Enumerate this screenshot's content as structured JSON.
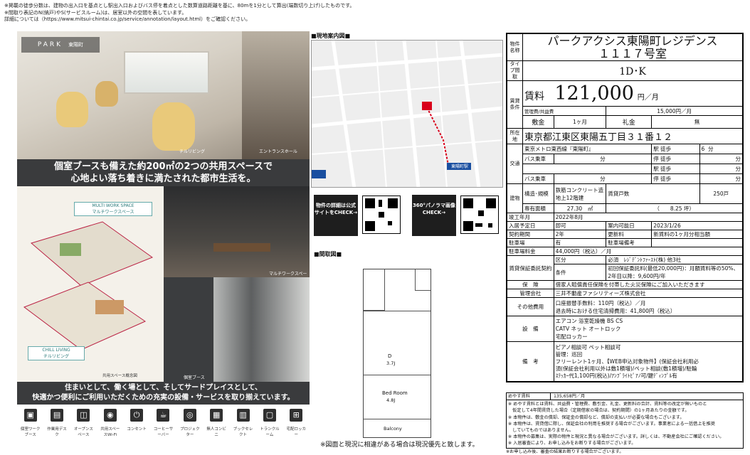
{
  "notes": [
    "※掲載の徒歩分数は、建物の出入口を基点とし駅出入口およびバス停を着点とした数算道路距離を基に、80mを1分として算出(端数切り上げ)したものです。",
    "※間取り表記のN(納戸)やS(サービスルーム)は、居室以外の空間を表しています。",
    "詳細については（https://www.mitsui-chintai.co.jp/service/annotation/layout.html）をご確認ください。"
  ],
  "photos": {
    "logo_text": "PARK",
    "logo_sub": "東陽町",
    "caption1_line1": "個室ブースも備えた約200㎡の2つの共用スペースで",
    "caption1_line2": "心地よい落ち着きに満たされた都市生活を。",
    "caption2_line1": "住まいとして、働く場として、そしてサードプレイスとして、",
    "caption2_line2": "快適かつ便利にご利用いただくための充実の設備・サービスを取り揃えています。",
    "plan_label_top": "MULTI WORK SPACE",
    "plan_label_top_jp": "マルチワークスペース",
    "plan_label_bottom": "CHILL LIVING",
    "plan_label_bottom_jp": "チルリビング",
    "plan_caption": "共用スペース概念図",
    "sub1": "チルリビング",
    "sub2": "エントランスホール",
    "sub3": "マルチワークスペース",
    "sub4": "個室ブース",
    "icons": [
      "個室ワークブース",
      "作業用デスク",
      "オープンスペース",
      "共用スペースWi-Fi",
      "コンセント",
      "コーヒーサーバー",
      "プロジェクター",
      "無人コンビニ",
      "ブックセレクト",
      "トランクルーム",
      "宅配ロッカー"
    ]
  },
  "map": {
    "title": "■現地案内図■",
    "station": "東陽町駅"
  },
  "qr": {
    "badge1": "物件の詳細は公式サイトをCHECK→",
    "badge2": "360°パノラマ画像CHECK→"
  },
  "floorplan": {
    "title": "■間取図■",
    "room_label": "Bed Room",
    "room_size": "4.8J",
    "dk_label": "D",
    "dk_size": "3.7J",
    "balcony": "Balcony"
  },
  "disclaimer": "※図面と現況に相違がある場合は現況優先と致します。",
  "property": {
    "name_label": "物件名称",
    "name_line1": "パークアクシス東陽町レジデンス",
    "name_line2": "１１１７号室",
    "type_label": "タイプ間取",
    "type": "1D･K",
    "rent_group_label": "賃貸条件",
    "rent_label": "賃料",
    "rent_value": "121,000",
    "rent_unit": "円／月",
    "mgmt_label": "管理費/共益費",
    "mgmt_value": "15,000円／月",
    "deposit_label": "敷金",
    "deposit_value": "1ヶ月",
    "key_label": "礼金",
    "key_value": "無",
    "address_label": "所在地",
    "address": "東京都江東区東陽五丁目３１番１２",
    "transport_label": "交通",
    "line1": "東京メトロ東西線『東陽町』",
    "walk_label": "駅 徒歩",
    "walk1": "6",
    "min": "分",
    "bus_label": "バス乗車",
    "stop_label": "停 徒歩",
    "building_label": "建物",
    "struct_label": "構造･規模",
    "struct_value1": "鉄筋コンクリート造",
    "struct_value2": "地上12階建",
    "units_label": "賃貸戸数",
    "units_value": "250戸",
    "area_label": "専有面積",
    "area_value": "27.30　㎡",
    "area_tsubo": "（　　8.25 坪）",
    "completed_label": "竣工年月",
    "completed_value": "2022年8月",
    "movein_label": "入居予定日",
    "movein_value": "即可",
    "info_date_label": "案内可能日",
    "info_date_value": "2023/1/26",
    "contract_label": "契約期間",
    "contract_value": "2年",
    "renewal_label": "更新料",
    "renewal_value": "新賃料の1ヶ月分相当額",
    "parking_label": "駐車場",
    "parking_value": "有",
    "parking_info_label": "駐車場備考",
    "parking_fee_label": "駐車場料金",
    "parking_fee_value": "44,000円（税込）／月",
    "guarantee_label": "賃貸保証委託契約",
    "guarantee_kubun_label": "区分",
    "guarantee_kubun_value": "必須　ﾚｼﾞﾃﾞﾝﾄﾌｧｰｽﾄ(株) 他3社",
    "guarantee_cond_label": "条件",
    "guarantee_cond_value1": "初回保証委託料(最低20,000円)：月額賃料等の50%、",
    "guarantee_cond_value2": "2年目以降：9,600円/年",
    "insurance_label": "保　険",
    "insurance_value": "借家人賠償責任保険を付帯した火災保険にご加入いただきます",
    "mgmt_co_label": "管理会社",
    "mgmt_co_value": "三井不動産ファシリティーズ株式会社",
    "other_label": "その他費用",
    "other_value1": "口座振替手数料：110円（税込）／月",
    "other_value2": "退去時における住宅清掃費用：41,800円（税込）",
    "equip_label": "設　備",
    "equip_value1": "エアコン 浴室乾燥機 BS CS",
    "equip_value2": "CATV ネット オートロック",
    "equip_value3": "宅配ロッカー",
    "remarks_label": "備　考",
    "remarks_value1": "ピアノ相談可 ペット相談可",
    "remarks_value2": "管理：巡回",
    "remarks_value3": "フリーレント1ヶ月、【WEB申込対象物件】(保証会社利用必",
    "remarks_value4": "須(保証会社利用以外は敷1積増)/ペット相談(敷1積増)/駐輪",
    "remarks_value5": "ｽﾃｯｶｰ代1,100円(税込)/ｱﾝﾌﾞﾗｲﾄﾋﾟｱﾉ可/鍵ﾃﾞｨﾝﾌﾟﾙ有"
  },
  "bottom_notes": {
    "target_label": "めやす賃料",
    "target_value": "135,658円／月",
    "lines": [
      "※ めやす賃料とは賃料、共益費・管理費、敷引金、礼金、更新料の合計、賃料等の改定が無いものと",
      "　仮定して4年間賃貸した場合（定期借家の場合は、契約期間）の1ヶ月あたりの金額です。",
      "※ 本物件は、敷金の償却、保証金の償却など、償却の支払いが必要な場合もございます。",
      "※ 本物件は、賃貸借に際し、保証会社の利用を推奨する場合がございます。事業者による一括借上を推奨",
      "　していてものではありません。",
      "※ 本物件の募集は、実際の物件と現況と異なる場合がございます。詳しくは、不動産会社にご確認ください。",
      "※ 入居審査により、お申し込みをお断りする場合がございます。"
    ],
    "footer": "※お申し込み後、審査の結果お断りする場合がございます。"
  },
  "colors": {
    "accent_red": "#d9001b",
    "photo_dark": "#3a3b3d",
    "plan_red": "#c62828"
  }
}
